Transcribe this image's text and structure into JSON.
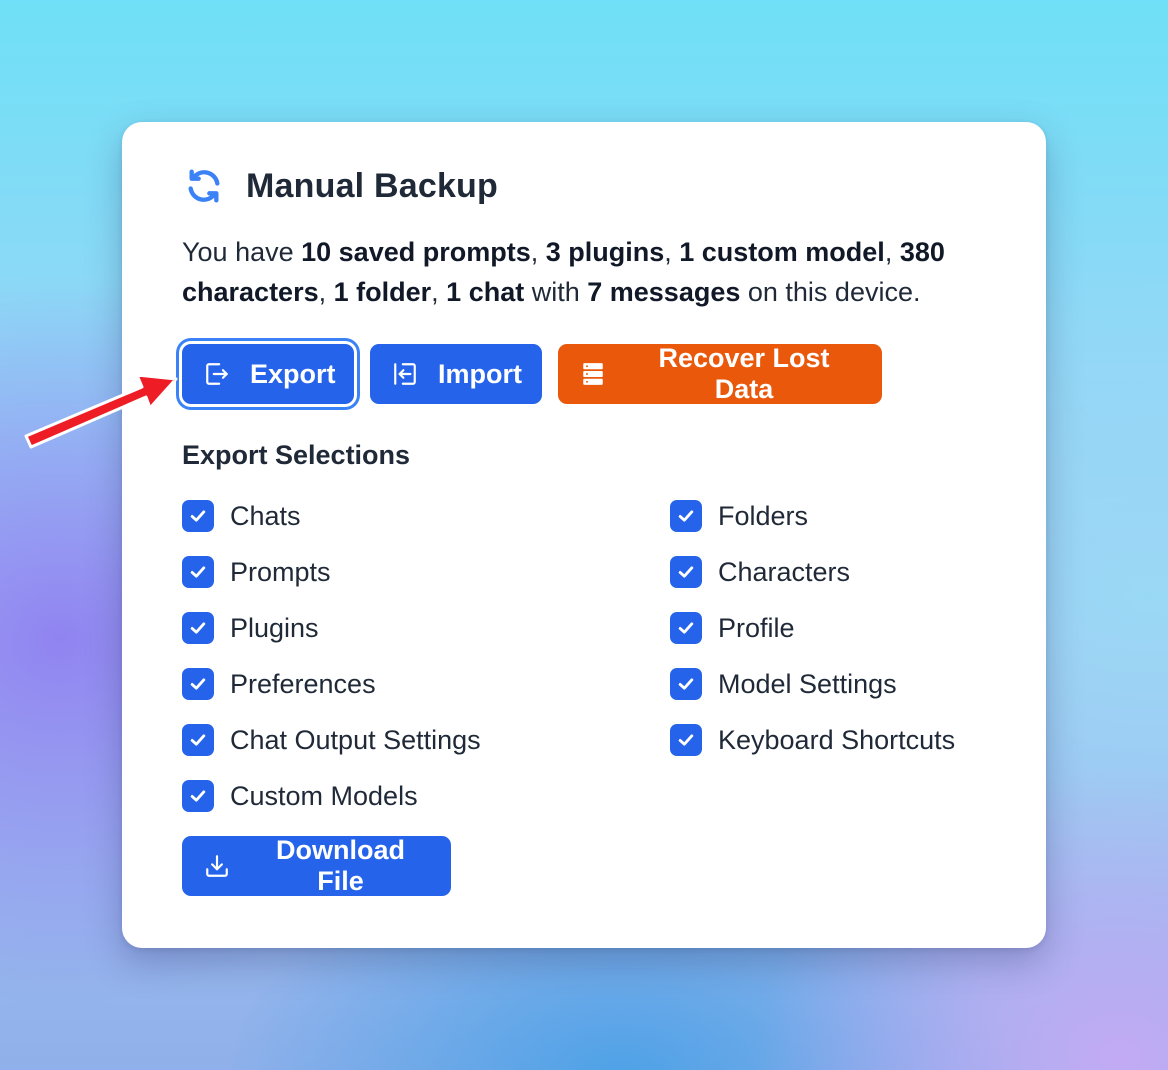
{
  "header": {
    "title": "Manual Backup",
    "icon": "sync-icon"
  },
  "summary": {
    "prefix": "You have ",
    "prompts": "10 saved prompts",
    "sep1": ", ",
    "plugins": "3 plugins",
    "sep2": ", ",
    "models": "1 custom model",
    "sep3": ", ",
    "characters": "380 characters",
    "sep4": ", ",
    "folders": "1 folder",
    "sep5": ", ",
    "chats": "1 chat",
    "mid": " with ",
    "messages": "7 messages",
    "suffix": " on this device."
  },
  "actions": {
    "export_label": "Export",
    "import_label": "Import",
    "recover_label": "Recover Lost Data"
  },
  "export_selections": {
    "title": "Export Selections",
    "left": [
      {
        "label": "Chats",
        "checked": true
      },
      {
        "label": "Prompts",
        "checked": true
      },
      {
        "label": "Plugins",
        "checked": true
      },
      {
        "label": "Preferences",
        "checked": true
      },
      {
        "label": "Chat Output Settings",
        "checked": true
      },
      {
        "label": "Custom Models",
        "checked": true
      }
    ],
    "right": [
      {
        "label": "Folders",
        "checked": true
      },
      {
        "label": "Characters",
        "checked": true
      },
      {
        "label": "Profile",
        "checked": true
      },
      {
        "label": "Model Settings",
        "checked": true
      },
      {
        "label": "Keyboard Shortcuts",
        "checked": true
      }
    ]
  },
  "download": {
    "label": "Download File"
  },
  "colors": {
    "primary": "#2563eb",
    "warning": "#ea580c",
    "annotation_arrow": "#ee1c24"
  }
}
